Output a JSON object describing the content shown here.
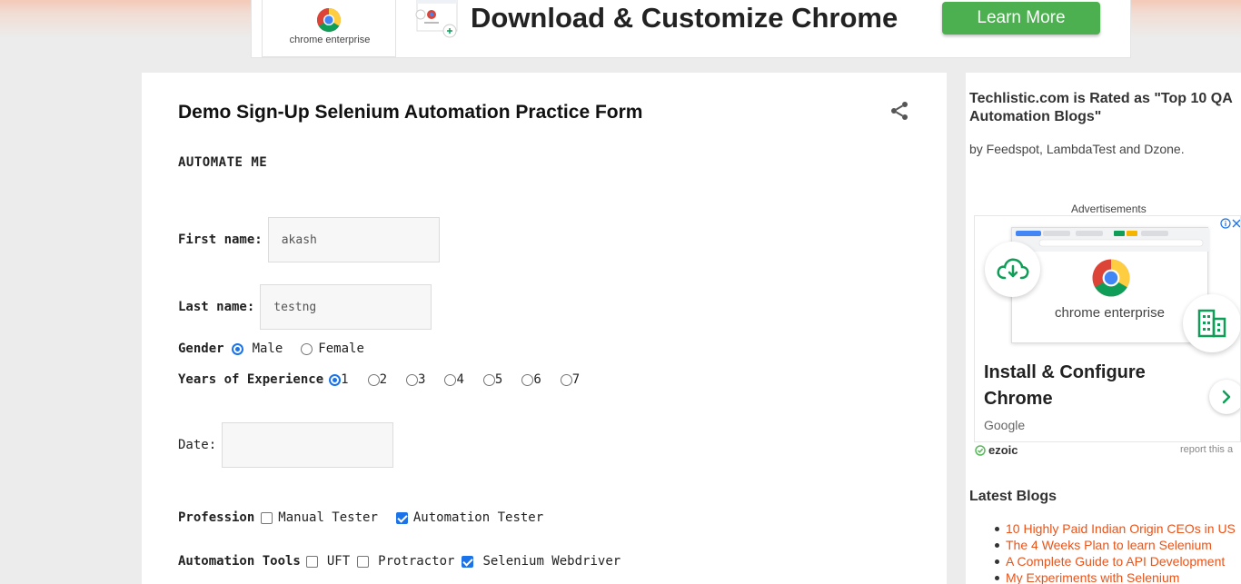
{
  "banner": {
    "logo_text": "chrome enterprise",
    "headline": "Download & Customize Chrome",
    "cta_label": "Learn More",
    "cta_color": "#4cb050"
  },
  "form": {
    "title": "Demo Sign-Up Selenium Automation Practice Form",
    "share_icon": "share-icon",
    "subheading": "AUTOMATE ME",
    "first_name": {
      "label": "First name:",
      "value": "akash"
    },
    "last_name": {
      "label": "Last name:",
      "value": "testng"
    },
    "gender": {
      "label": "Gender",
      "options": [
        {
          "label": "Male",
          "selected": true
        },
        {
          "label": "Female",
          "selected": false
        }
      ]
    },
    "experience": {
      "label": "Years of Experience",
      "options": [
        {
          "label": "1",
          "selected": true
        },
        {
          "label": "2",
          "selected": false
        },
        {
          "label": "3",
          "selected": false
        },
        {
          "label": "4",
          "selected": false
        },
        {
          "label": "5",
          "selected": false
        },
        {
          "label": "6",
          "selected": false
        },
        {
          "label": "7",
          "selected": false
        }
      ]
    },
    "date": {
      "label": "Date:",
      "value": ""
    },
    "profession": {
      "label": "Profession",
      "options": [
        {
          "label": "Manual Tester",
          "checked": false
        },
        {
          "label": "Automation Tester",
          "checked": true
        }
      ]
    },
    "tools": {
      "label": "Automation Tools",
      "options": [
        {
          "label": "UFT",
          "checked": false
        },
        {
          "label": "Protractor",
          "checked": false
        },
        {
          "label": "Selenium Webdriver",
          "checked": true
        }
      ]
    },
    "accent_color": "#1a73e8"
  },
  "sidebar": {
    "title": "Techlistic.com is Rated as \"Top 10 QA Automation Blogs\"",
    "subtitle": "by Feedspot, LambdaTest and Dzone.",
    "ads_label": "Advertisements",
    "ad": {
      "brand_text": "chrome enterprise",
      "headline": "Install & Configure Chrome",
      "advertiser": "Google",
      "ezoic_label": "ezoic",
      "report_label": "report this a"
    },
    "latest_heading": "Latest Blogs",
    "latest_items": [
      "10 Highly Paid Indian Origin CEOs in US",
      "The 4 Weeks Plan to learn Selenium",
      "A Complete Guide to API Development",
      "My Experiments with Selenium"
    ],
    "link_color": "#e8541a"
  }
}
